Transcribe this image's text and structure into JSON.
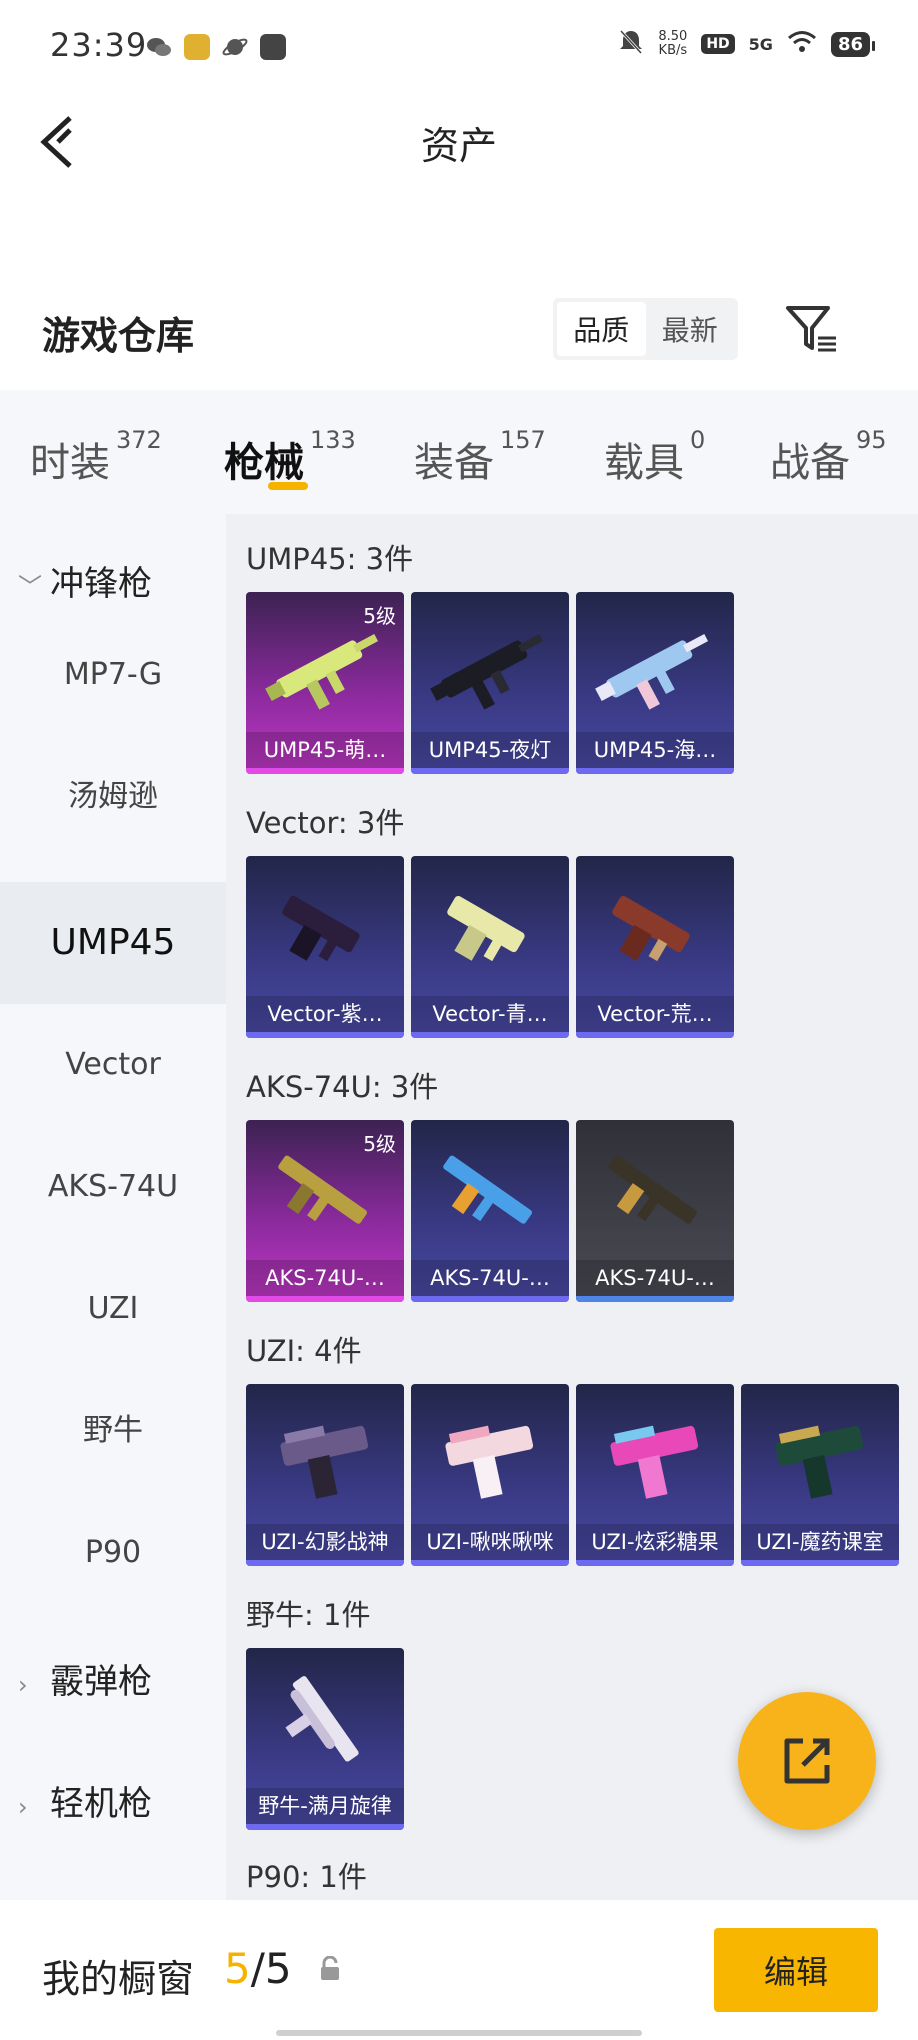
{
  "status_bar": {
    "time": "23:39",
    "net_speed_value": "8.50",
    "net_speed_unit": "KB/s",
    "hd": "HD",
    "network": "5G",
    "battery": "86"
  },
  "header": {
    "title": "资产"
  },
  "warehouse": {
    "title": "游戏仓库",
    "sort_options": [
      "品质",
      "最新"
    ],
    "sort_selected": "品质"
  },
  "tabs": [
    {
      "label": "时装",
      "count": "372"
    },
    {
      "label": "枪械",
      "count": "133",
      "active": true
    },
    {
      "label": "装备",
      "count": "157"
    },
    {
      "label": "载具",
      "count": "0"
    },
    {
      "label": "战备",
      "count": "95"
    }
  ],
  "sidebar": {
    "categories": [
      {
        "label": "冲锋枪",
        "expanded": true
      },
      {
        "label": "霰弹枪",
        "expanded": false
      },
      {
        "label": "轻机枪",
        "expanded": false
      }
    ],
    "items": [
      "MP7-G",
      "汤姆逊",
      "UMP45",
      "Vector",
      "AKS-74U",
      "UZI",
      "野牛",
      "P90"
    ],
    "selected": "UMP45"
  },
  "groups": [
    {
      "title": "UMP45: 3件",
      "items": [
        {
          "label": "UMP45-萌…",
          "level": "5级",
          "quality": "pink"
        },
        {
          "label": "UMP45-夜灯",
          "quality": "purple"
        },
        {
          "label": "UMP45-海…",
          "quality": "purple"
        }
      ]
    },
    {
      "title": "Vector: 3件",
      "items": [
        {
          "label": "Vector-紫…",
          "quality": "purple"
        },
        {
          "label": "Vector-青…",
          "quality": "purple"
        },
        {
          "label": "Vector-荒…",
          "quality": "purple"
        }
      ]
    },
    {
      "title": "AKS-74U: 3件",
      "items": [
        {
          "label": "AKS-74U-…",
          "level": "5级",
          "quality": "pink"
        },
        {
          "label": "AKS-74U-…",
          "quality": "purple"
        },
        {
          "label": "AKS-74U-…",
          "quality": "gray"
        }
      ]
    },
    {
      "title": "UZI: 4件",
      "items": [
        {
          "label": "UZI-幻影战神",
          "quality": "purple"
        },
        {
          "label": "UZI-啾咪啾咪",
          "quality": "purple"
        },
        {
          "label": "UZI-炫彩糖果",
          "quality": "purple"
        },
        {
          "label": "UZI-魔药课室",
          "quality": "purple"
        }
      ]
    },
    {
      "title": "野牛: 1件",
      "items": [
        {
          "label": "野牛-满月旋律",
          "quality": "purple"
        }
      ]
    },
    {
      "title": "P90: 1件",
      "items": []
    }
  ],
  "showcase": {
    "title": "我的橱窗",
    "current": "5",
    "separator": "/",
    "total": "5",
    "edit_label": "编辑"
  },
  "colors": {
    "accent": "#f5b300",
    "card_purple": "#4a4aa6",
    "card_pink": "#c038c6",
    "card_gray": "#4a4b54"
  },
  "icons": {
    "back": "back-arrow-icon",
    "filter": "filter-icon",
    "share": "share-external-icon",
    "lock": "lock-open-icon"
  }
}
